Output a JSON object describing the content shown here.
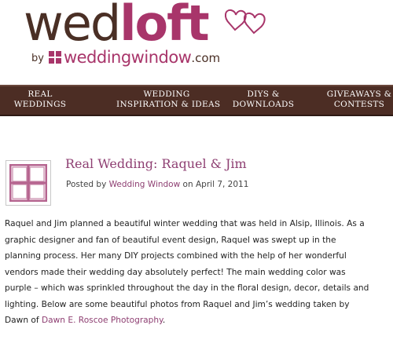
{
  "logo": {
    "word_part1": "wed",
    "word_part2": "loft",
    "by": "by",
    "brand": "weddingwindow",
    "tld": ".com",
    "brand_color": "#a8356a",
    "dark_color": "#4a2f25"
  },
  "nav": {
    "items": [
      {
        "line1": "REAL",
        "line2": "WEDDINGS"
      },
      {
        "line1": "WEDDING",
        "line2": "INSPIRATION & IDEAS"
      },
      {
        "line1": "DIYS &",
        "line2": "DOWNLOADS"
      },
      {
        "line1": "GIVEAWAYS &",
        "line2": "CONTESTS"
      }
    ],
    "bar_color": "#4c2d24"
  },
  "post": {
    "title": "Real Wedding: Raquel & Jim",
    "posted_by_label": "Posted by",
    "author": "Wedding Window",
    "on_label": "on",
    "date": "April 7, 2011",
    "body_lines": [
      "Raquel and Jim planned a beautiful winter wedding that was held in Alsip, Illinois.  As a",
      "graphic designer and fan of beautiful event design, Raquel was swept up in the",
      "planning process.  Her many DIY projects combined with the help of her wonderful",
      "vendors made their wedding day absolutely perfect!  The main wedding color was",
      "purple – which was sprinkled throughout the day in the floral design, decor, details and",
      "lighting. Below are some beautiful photos from Raquel and Jim’s wedding taken by"
    ],
    "last_line_prefix": "Dawn of",
    "photographer": "Dawn E. Roscoe Photography",
    "last_line_suffix": ".",
    "link_color": "#8e3f72"
  }
}
